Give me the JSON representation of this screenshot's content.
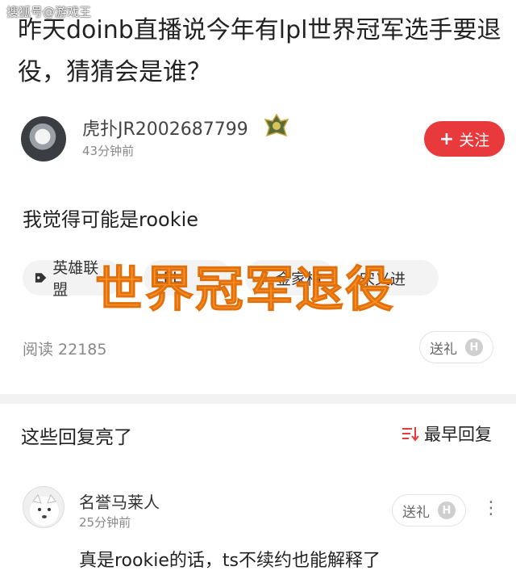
{
  "watermark": "搜狐号@游戏王",
  "post": {
    "title": "昨天doinb直播说今年有lpl世界冠军选手要退役，猜猜会是谁？",
    "author": {
      "name": "虎扑JR2002687799",
      "time": "43分钟前"
    },
    "follow_label": "关注",
    "follow_icon": "plus-icon",
    "body": "我觉得可能是rookie",
    "tags": [
      {
        "label": "英雄联盟",
        "icon": "tag-icon"
      },
      {
        "label": "LPL",
        "icon": ""
      },
      {
        "label": "金家柏",
        "icon": "plus-icon"
      },
      {
        "label": "宋义进",
        "icon": ""
      }
    ],
    "overlay_text": "世界冠军退役",
    "read_count": "阅读 22185",
    "gift_label": "送礼",
    "gift_coin": "H"
  },
  "replies": {
    "section_title": "这些回复亮了",
    "sort_label": "最早回复",
    "sort_icon": "sort-icon",
    "items": [
      {
        "name": "名誉马莱人",
        "time": "25分钟前",
        "text": "真是rookie的话，ts不续约也能解释了",
        "gift_label": "送礼",
        "gift_coin": "H"
      }
    ]
  },
  "colors": {
    "accent": "#e8393c",
    "overlay": "#ff8c1a"
  }
}
